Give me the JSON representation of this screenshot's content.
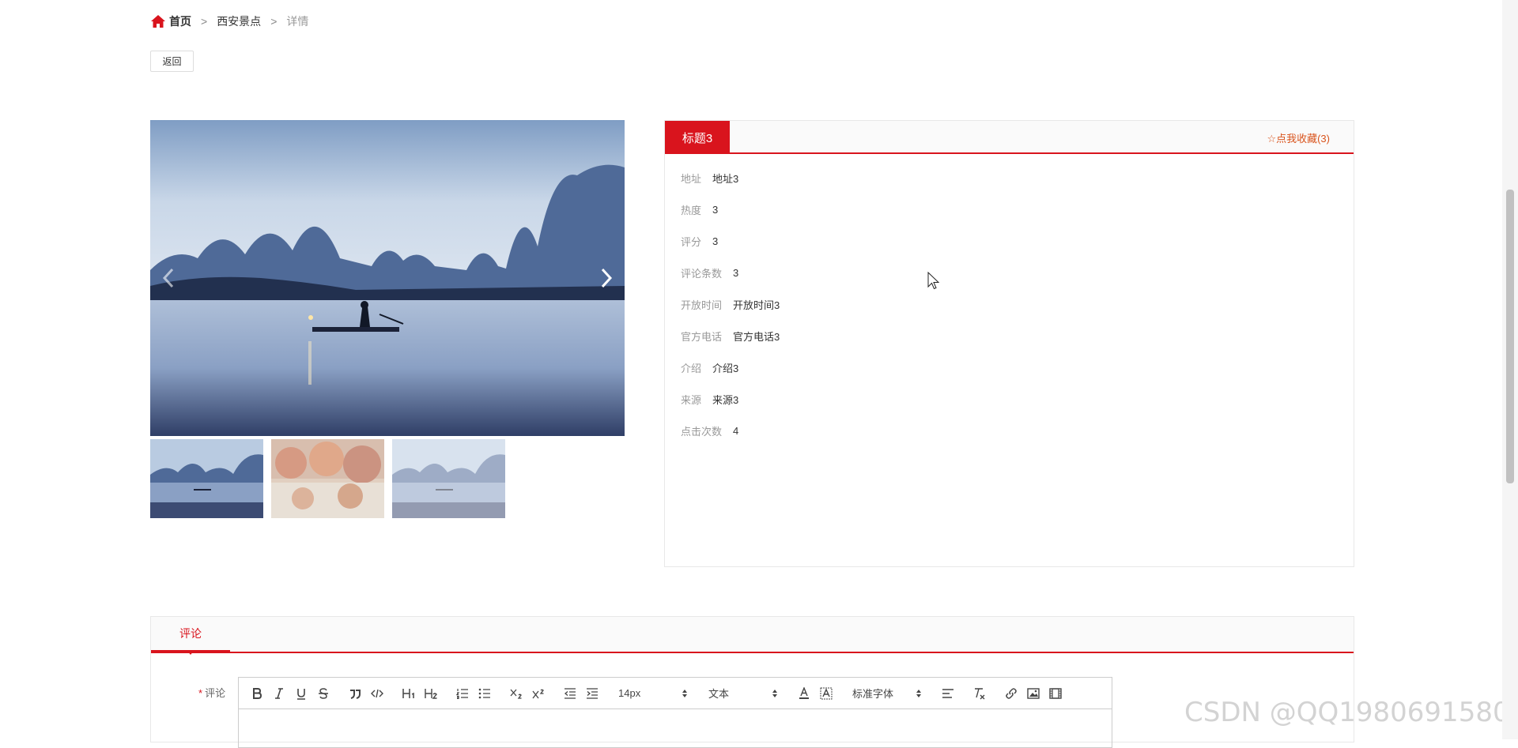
{
  "breadcrumb": {
    "home": "首页",
    "separator": ">",
    "section": "西安景点",
    "current": "详情"
  },
  "back_label": "返回",
  "detail": {
    "title": "标题3",
    "favorite_label": "☆点我收藏(3)",
    "rows": [
      {
        "label": "地址",
        "value": "地址3"
      },
      {
        "label": "热度",
        "value": "3"
      },
      {
        "label": "评分",
        "value": "3"
      },
      {
        "label": "评论条数",
        "value": "3"
      },
      {
        "label": "开放时间",
        "value": "开放时间3"
      },
      {
        "label": "官方电话",
        "value": "官方电话3"
      },
      {
        "label": "介绍",
        "value": "介绍3"
      },
      {
        "label": "来源",
        "value": "来源3"
      },
      {
        "label": "点击次数",
        "value": "4"
      }
    ]
  },
  "comment": {
    "tab_label": "评论",
    "required_mark": "*",
    "field_label": "评论",
    "toolbar": {
      "font_size": "14px",
      "block_type": "文本",
      "font_family": "标准字体"
    }
  },
  "watermark": "CSDN @QQ1980691580",
  "colors": {
    "accent": "#d9141d",
    "favorite": "#d9541d"
  }
}
